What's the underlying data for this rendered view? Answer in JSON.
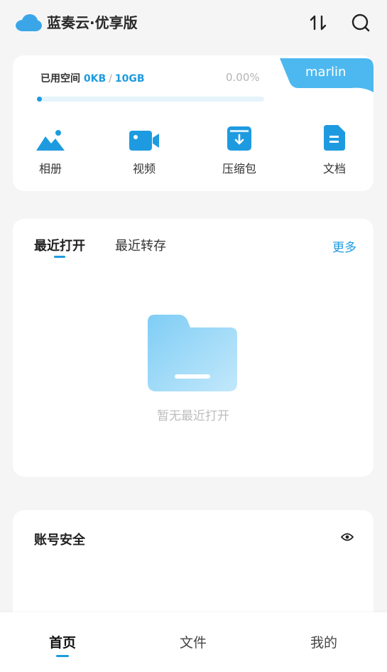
{
  "header": {
    "app_title": "蓝奏云·优享版",
    "logo_icon": "cloud-icon",
    "transfer_icon": "transfer-icon",
    "search_icon": "search-icon"
  },
  "storage": {
    "label": "已用空间",
    "used": "0KB",
    "separator": "/",
    "total": "10GB",
    "percent_text": "0.00%",
    "progress_fraction": 0.0,
    "username": "marlin"
  },
  "quick_access": [
    {
      "label": "相册",
      "icon": "photo-album-icon"
    },
    {
      "label": "视频",
      "icon": "video-icon"
    },
    {
      "label": "压缩包",
      "icon": "archive-icon"
    },
    {
      "label": "文档",
      "icon": "document-icon"
    }
  ],
  "recent": {
    "tabs": [
      "最近打开",
      "最近转存"
    ],
    "more_label": "更多",
    "empty_text": "暂无最近打开",
    "empty_icon": "folder-icon"
  },
  "security": {
    "title": "账号安全",
    "eye_icon": "eye-icon"
  },
  "bottom_nav": {
    "items": [
      "首页",
      "文件",
      "我的"
    ],
    "active_index": 0
  },
  "colors": {
    "accent": "#1e9be0",
    "badge": "#4db8f0",
    "background": "#f5f5f6"
  }
}
